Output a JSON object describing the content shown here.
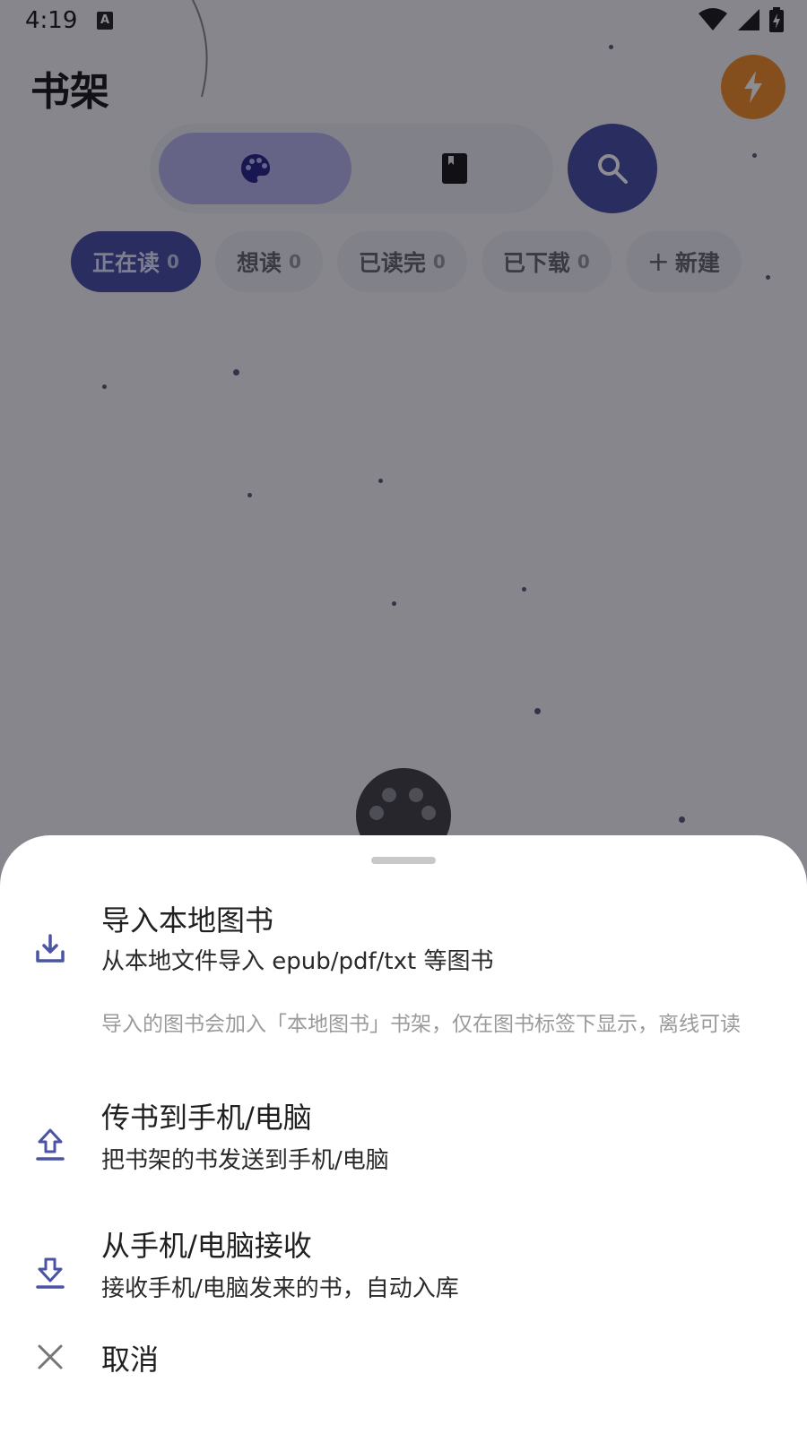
{
  "status_bar": {
    "time": "4:19",
    "keyboard_badge": "A"
  },
  "header": {
    "title": "书架"
  },
  "colors": {
    "accent": "#4b53a4",
    "accent_light": "#b8b7ec",
    "bolt": "#f0912a",
    "icon": "#4b53a4"
  },
  "filters": [
    {
      "label": "正在读",
      "count": "0"
    },
    {
      "label": "想读",
      "count": "0"
    },
    {
      "label": "已读完",
      "count": "0"
    },
    {
      "label": "已下载",
      "count": "0"
    }
  ],
  "new_chip": {
    "plus": "+",
    "label": "新建"
  },
  "sheet": {
    "import": {
      "title": "导入本地图书",
      "subtitle": "从本地文件导入 epub/pdf/txt 等图书"
    },
    "note": "导入的图书会加入「本地图书」书架，仅在图书标签下显示，离线可读",
    "send": {
      "title": "传书到手机/电脑",
      "subtitle": "把书架的书发送到手机/电脑"
    },
    "receive": {
      "title": "从手机/电脑接收",
      "subtitle": "接收手机/电脑发来的书，自动入库"
    },
    "cancel": {
      "title": "取消"
    }
  }
}
